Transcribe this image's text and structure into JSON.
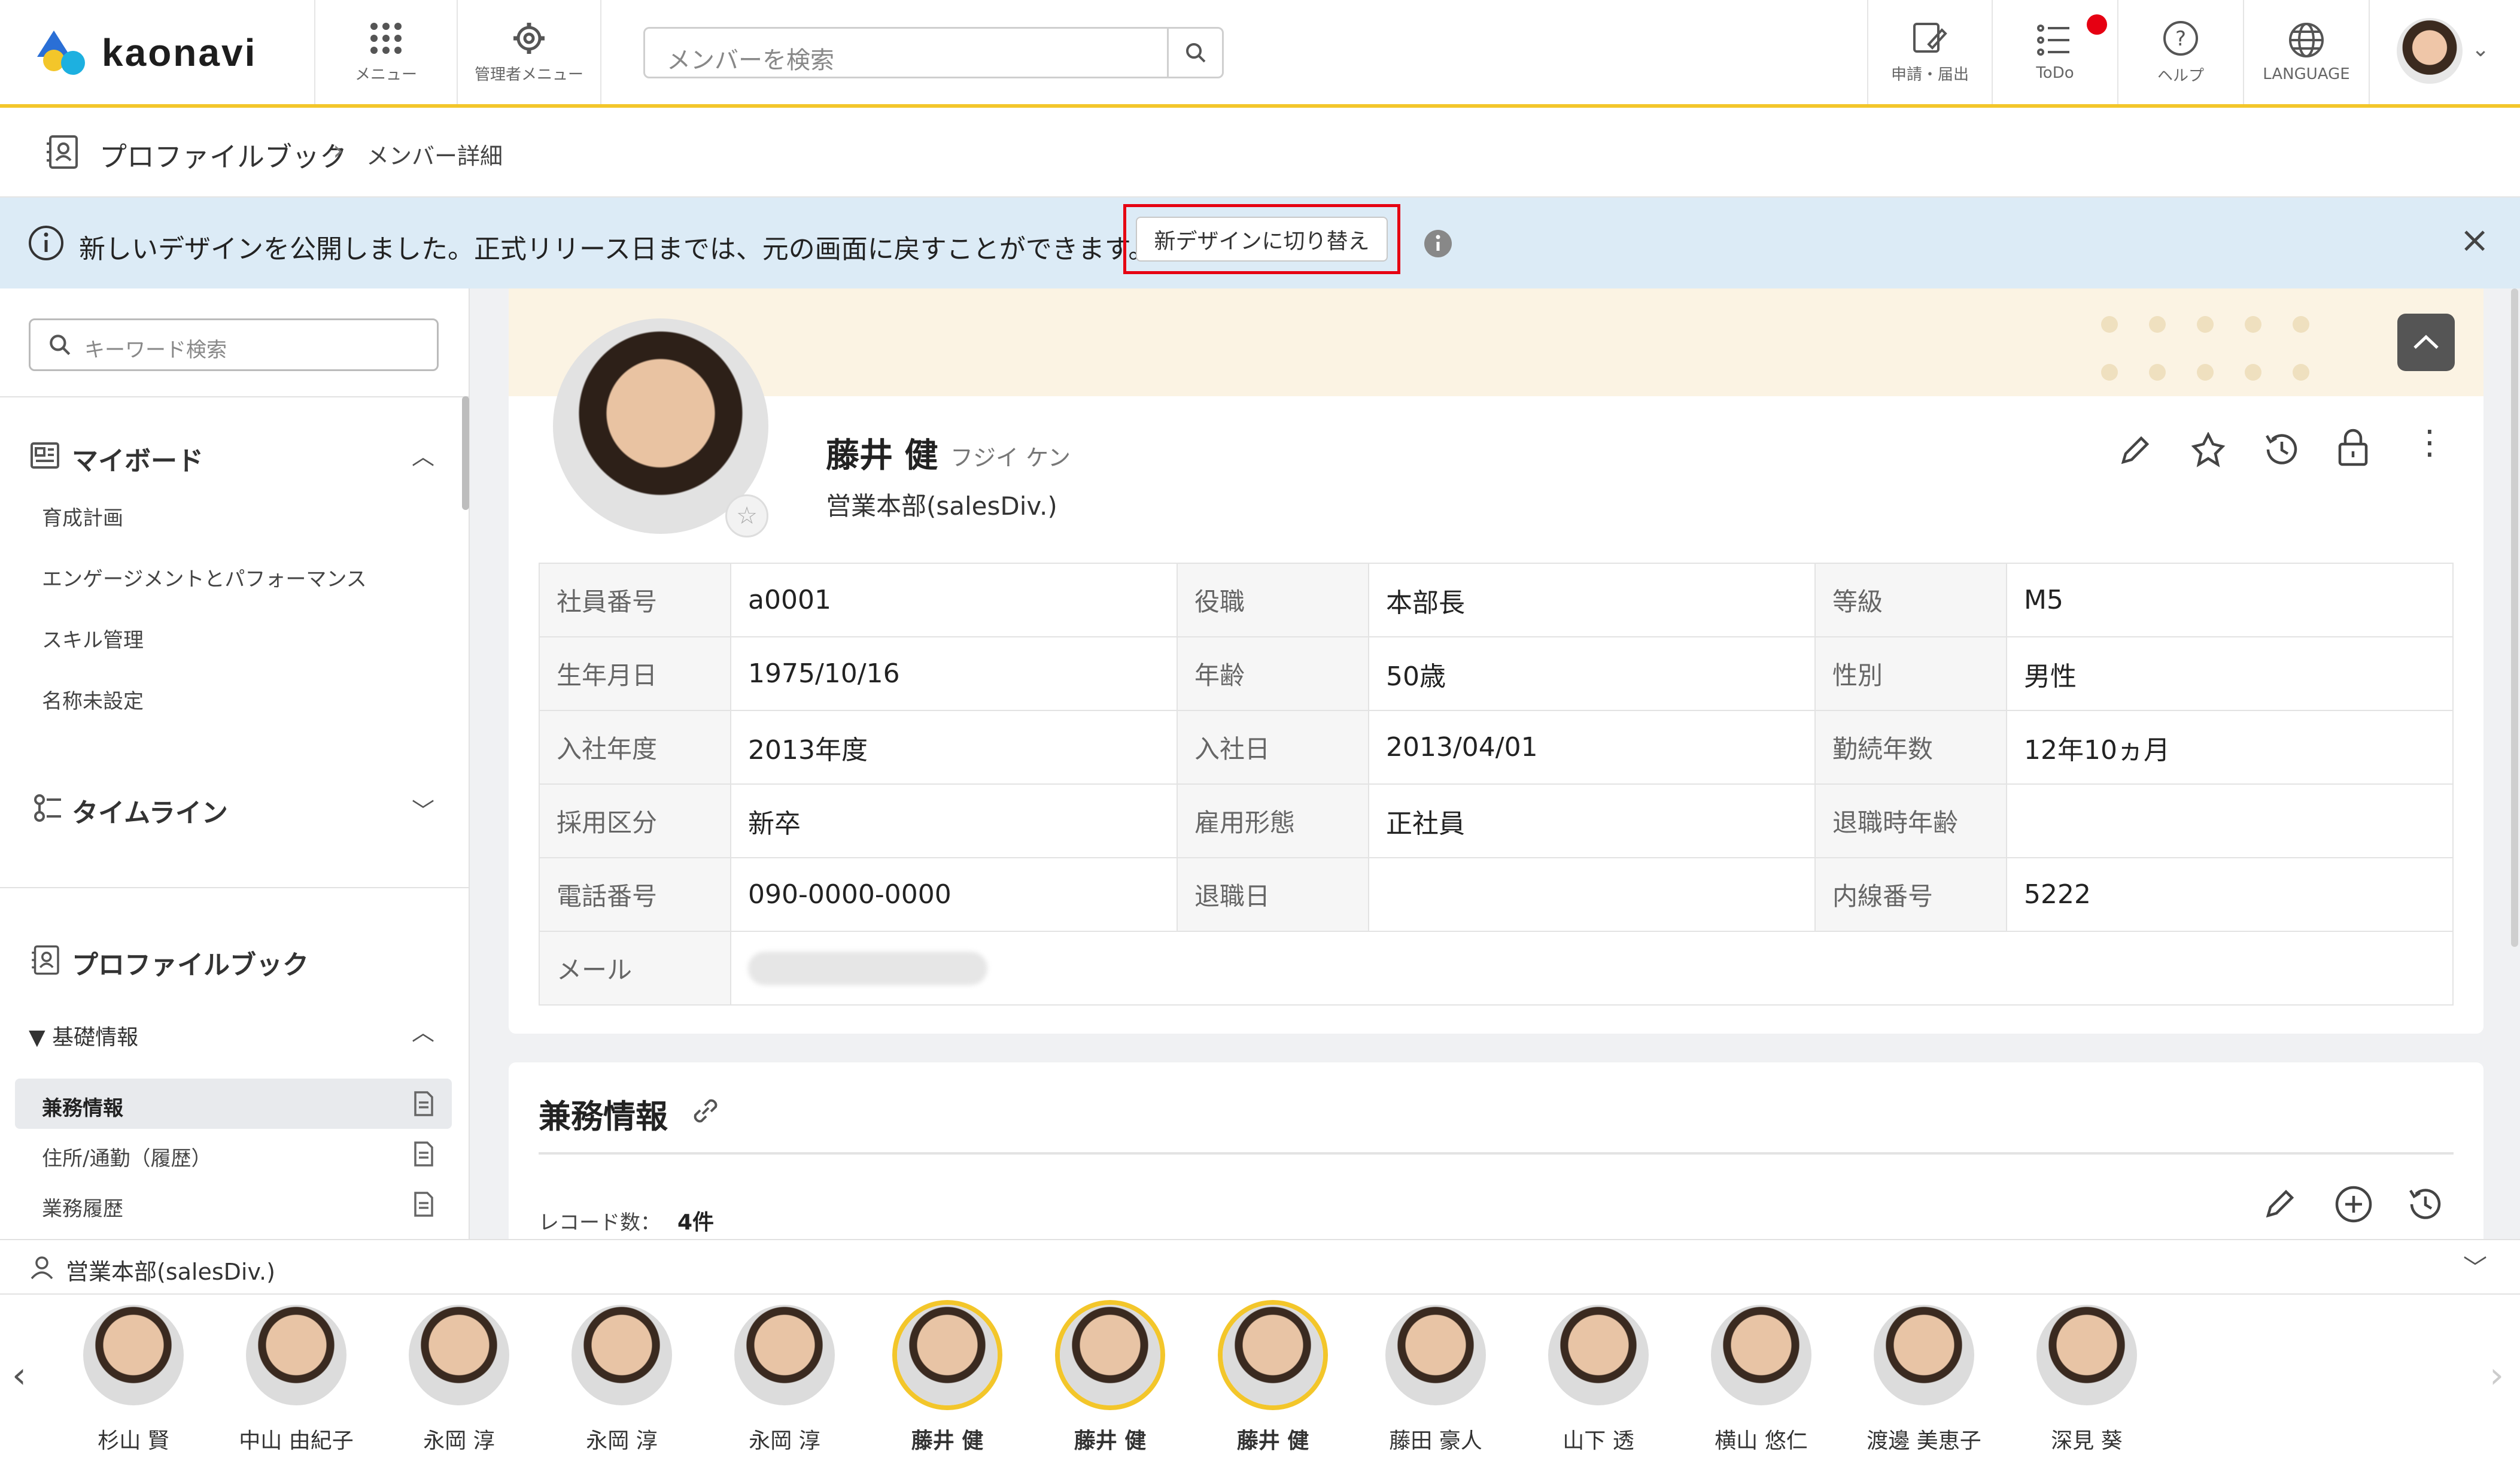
{
  "header": {
    "logo_text": "kaonavi",
    "menu_label": "メニュー",
    "admin_menu_label": "管理者メニュー",
    "search_placeholder": "メンバーを検索",
    "apply_label": "申請・届出",
    "todo_label": "ToDo",
    "help_label": "ヘルプ",
    "language_label": "LANGUAGE"
  },
  "breadcrumb": {
    "root": "プロファイルブック",
    "sep": "›",
    "current": "メンバー詳細"
  },
  "banner": {
    "message": "新しいデザインを公開しました。正式リリース日までは、元の画面に戻すことができます。",
    "button_label": "新デザインに切り替え"
  },
  "sidebar": {
    "search_placeholder": "キーワード検索",
    "myboard_title": "マイボード",
    "myboard_items": [
      "育成計画",
      "エンゲージメントとパフォーマンス",
      "スキル管理",
      "名称未設定"
    ],
    "timeline_title": "タイムライン",
    "profilebook_title": "プロファイルブック",
    "basic_group": "▼ 基礎情報",
    "basic_items": [
      "兼務情報",
      "住所/通勤（履歴）",
      "業務履歴"
    ]
  },
  "profile": {
    "name": "藤井 健",
    "kana": "フジイ ケン",
    "department": "営業本部(salesDiv.)",
    "rows": [
      [
        {
          "label": "社員番号",
          "value": "a0001"
        },
        {
          "label": "役職",
          "value": "本部長"
        },
        {
          "label": "等級",
          "value": "M5"
        }
      ],
      [
        {
          "label": "生年月日",
          "value": "1975/10/16"
        },
        {
          "label": "年齢",
          "value": "50歳"
        },
        {
          "label": "性別",
          "value": "男性"
        }
      ],
      [
        {
          "label": "入社年度",
          "value": "2013年度"
        },
        {
          "label": "入社日",
          "value": "2013/04/01"
        },
        {
          "label": "勤続年数",
          "value": "12年10ヵ月"
        }
      ],
      [
        {
          "label": "採用区分",
          "value": "新卒"
        },
        {
          "label": "雇用形態",
          "value": "正社員"
        },
        {
          "label": "退職時年齢",
          "value": ""
        }
      ],
      [
        {
          "label": "電話番号",
          "value": "090-0000-0000"
        },
        {
          "label": "退職日",
          "value": ""
        },
        {
          "label": "内線番号",
          "value": "5222"
        }
      ]
    ],
    "email_label": "メール"
  },
  "section": {
    "title": "兼務情報",
    "record_label": "レコード数：",
    "record_count": "4件"
  },
  "strip": {
    "group_label": "営業本部(salesDiv.)",
    "members": [
      {
        "name": "杉山 賢",
        "selected": false
      },
      {
        "name": "中山 由紀子",
        "selected": false
      },
      {
        "name": "永岡 淳",
        "selected": false
      },
      {
        "name": "永岡 淳",
        "selected": false
      },
      {
        "name": "永岡 淳",
        "selected": false
      },
      {
        "name": "藤井 健",
        "selected": true
      },
      {
        "name": "藤井 健",
        "selected": true
      },
      {
        "name": "藤井 健",
        "selected": true
      },
      {
        "name": "藤田 豪人",
        "selected": false
      },
      {
        "name": "山下 透",
        "selected": false
      },
      {
        "name": "横山 悠仁",
        "selected": false
      },
      {
        "name": "渡邊 美恵子",
        "selected": false
      },
      {
        "name": "深見 葵",
        "selected": false
      }
    ]
  },
  "colors": {
    "accent": "#f3c62a",
    "banner_bg": "#dcebf6",
    "highlight": "#e60012",
    "notify_dot": "#e60012"
  }
}
